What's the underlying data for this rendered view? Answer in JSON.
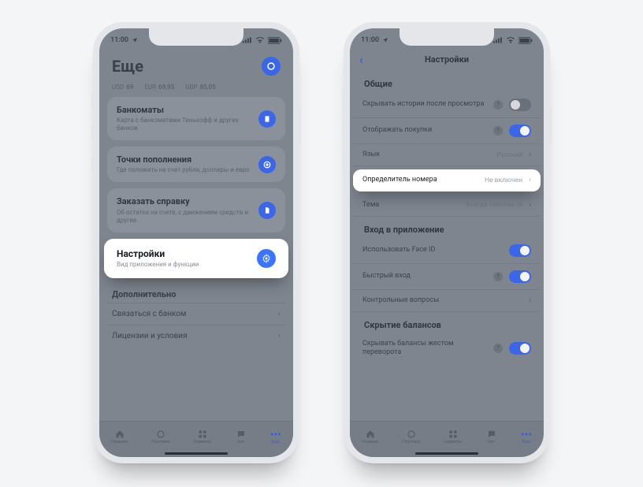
{
  "status": {
    "time": "11:00"
  },
  "left": {
    "header": "Еще",
    "rates": [
      {
        "code": "USD",
        "value": "69"
      },
      {
        "code": "EUR",
        "value": "69,95"
      },
      {
        "code": "GBP",
        "value": "85,05"
      }
    ],
    "cards": {
      "atm": {
        "title": "Банкоматы",
        "sub": "Карта с банкоматами Тинькофф и других банков"
      },
      "topup": {
        "title": "Точки пополнения",
        "sub": "Где положить на счет рубли, доллары и евро"
      },
      "cert": {
        "title": "Заказать справку",
        "sub": "Об остатке на счете, с движением средств и другие"
      },
      "settings": {
        "title": "Настройки",
        "sub": "Вид приложения и функции"
      }
    },
    "extra_title": "Дополнительно",
    "extra_rows": {
      "contact": "Связаться с банком",
      "license": "Лицензии и условия"
    }
  },
  "right": {
    "title": "Настройки",
    "groups": {
      "general": {
        "title": "Общие",
        "rows": {
          "hide_stories": {
            "label": "Скрывать истории после просмотра",
            "toggle": false,
            "help": true
          },
          "show_purchases": {
            "label": "Отображать покупки",
            "toggle": true,
            "help": true
          },
          "language": {
            "label": "Язык",
            "value": "Русский"
          },
          "caller_id": {
            "label": "Определитель номера",
            "value": "Не включен"
          },
          "theme": {
            "label": "Тема",
            "value": "Всегда светлая те"
          }
        }
      },
      "login": {
        "title": "Вход в приложение",
        "rows": {
          "faceid": {
            "label": "Использовать Face ID",
            "toggle": true
          },
          "quick": {
            "label": "Быстрый вход",
            "toggle": true,
            "help": true
          },
          "questions": {
            "label": "Контрольные вопросы"
          }
        }
      },
      "balances": {
        "title": "Скрытие балансов",
        "rows": {
          "hide_flip": {
            "label": "Скрывать балансы жестом переворота",
            "toggle": true,
            "help": true
          }
        }
      }
    }
  },
  "tabs": {
    "home": "Главная",
    "payments": "Платежи",
    "services": "Сервисы",
    "chat": "Чат",
    "more": "Еще"
  }
}
